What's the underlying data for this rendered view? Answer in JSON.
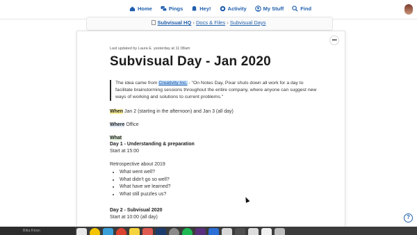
{
  "nav": {
    "items": [
      {
        "label": "Home",
        "icon": "home-icon"
      },
      {
        "label": "Pings",
        "icon": "pings-icon"
      },
      {
        "label": "Hey!",
        "icon": "hey-icon"
      },
      {
        "label": "Activity",
        "icon": "activity-icon"
      },
      {
        "label": "My Stuff",
        "icon": "my-stuff-icon"
      },
      {
        "label": "Find",
        "icon": "find-icon"
      }
    ]
  },
  "breadcrumb": {
    "project": "Subvisual HQ",
    "section": "Docs & Files",
    "current": "Subvisual Days",
    "separator": "›"
  },
  "doc": {
    "meta": "Last updated by Laura E. yesterday at 11:08am",
    "title": "Subvisual Day - Jan 2020",
    "quote_pre": "The idea came from ",
    "quote_link": "Creativity Inc.",
    "quote_post": " - \"On Notes Day, Pixar shuts down all work for a day to facilitate brainstorming sessions throughout the entire company, where anyone can suggest new ways of working and solutions to current problems.\"",
    "when_label": "When",
    "when_value": " Jan 2 (starting in the afternoon) and Jan 3 (all day)",
    "where_label": "Where",
    "where_value": " Office",
    "what_label": "What",
    "day1_title": "Day 1 - Understanding & preparation",
    "day1_start": "Start at 15:00",
    "retro": "Retrospective about 2019",
    "questions": [
      "What went well?",
      "What didn't go so well?",
      "What have we learned?",
      "What still puzzles us?"
    ],
    "day2_title": "Day 2 - Subvisual 2020",
    "day2_start": "Start at 10:00 (all day)"
  },
  "dock": {
    "label": "Bilia Kiran"
  },
  "colors": {
    "link": "#1f5fad",
    "highlight_yellow": "#fbf09a",
    "highlight_blue": "#bcd7f5"
  }
}
